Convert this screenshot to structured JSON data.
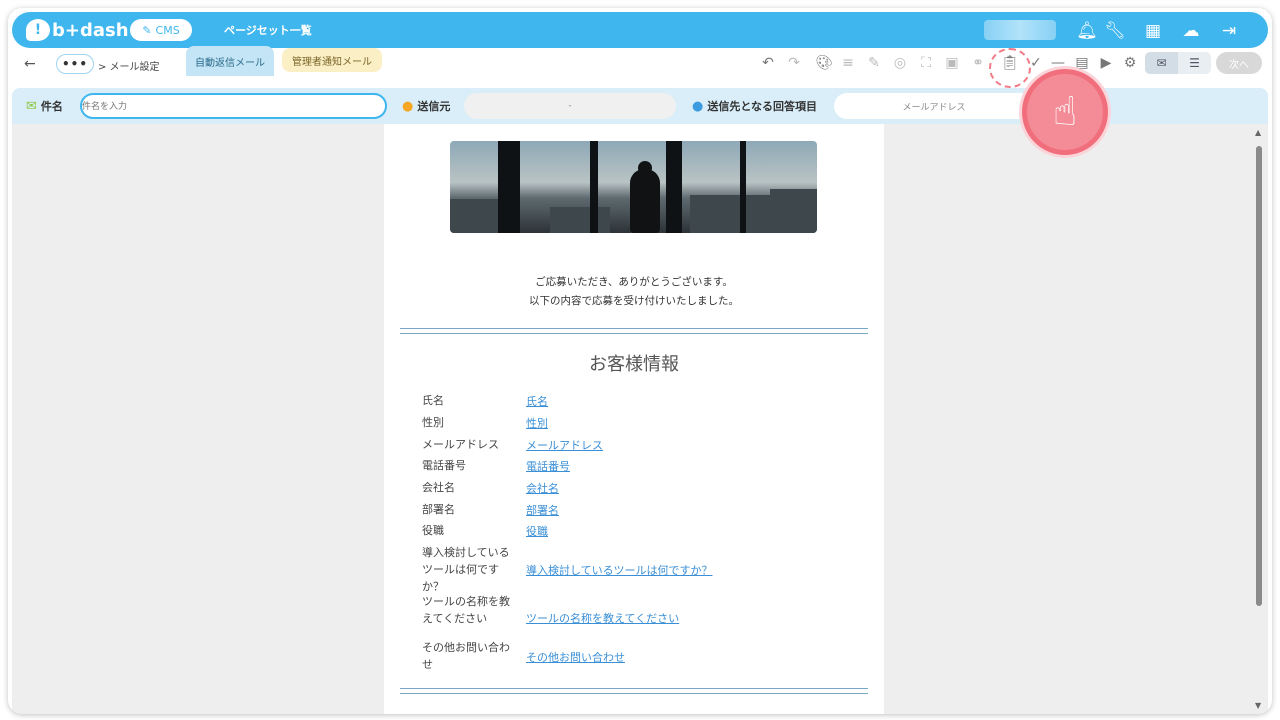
{
  "app": {
    "logo_text": "b+dash",
    "cms_label": "CMS",
    "page_set_label": "ページセット一覧"
  },
  "header_icons": [
    "bell-icon",
    "wrench-icon",
    "grid-icon",
    "support-icon",
    "logout-icon"
  ],
  "breadcrumb": {
    "dots": "•••",
    "path": "> メール設定"
  },
  "tabs": [
    {
      "label": "自動返信メール",
      "active": true
    },
    {
      "label": "管理者通知メール",
      "active": false
    }
  ],
  "toolbar": {
    "next_label": "次へ"
  },
  "fields": {
    "subject_label": "件名",
    "subject_placeholder": "件名を入力",
    "sender_label": "送信元",
    "sender_value": "-",
    "recipient_label": "送信先となる回答項目",
    "recipient_value": "メールアドレス"
  },
  "email": {
    "thanks_line1": "ご応募いただき、ありがとうございます。",
    "thanks_line2": "以下の内容で応募を受け付けいたしました。",
    "section_title": "お客様情報",
    "rows": [
      {
        "label": "氏名",
        "link": "氏名"
      },
      {
        "label": "性別",
        "link": "性別"
      },
      {
        "label": "メールアドレス",
        "link": "メールアドレス"
      },
      {
        "label": "電話番号",
        "link": "電話番号"
      },
      {
        "label": "会社名",
        "link": "会社名"
      },
      {
        "label": "部署名",
        "link": "部署名"
      },
      {
        "label": "役職",
        "link": "役職"
      },
      {
        "label": "導入検討しているツールは何ですか？",
        "link": "導入検討しているツールは何ですか？"
      },
      {
        "label": "ツールの名称を教えてください",
        "link": "ツールの名称を教えてください"
      },
      {
        "label": "その他お問い合わせ",
        "link": "その他お問い合わせ"
      }
    ]
  },
  "colors": {
    "brand": "#3fb6ee",
    "tab_active": "#c4e5f5",
    "tab_admin": "#fbefc6",
    "link": "#3a8fd6",
    "highlight": "#f16e7c"
  }
}
